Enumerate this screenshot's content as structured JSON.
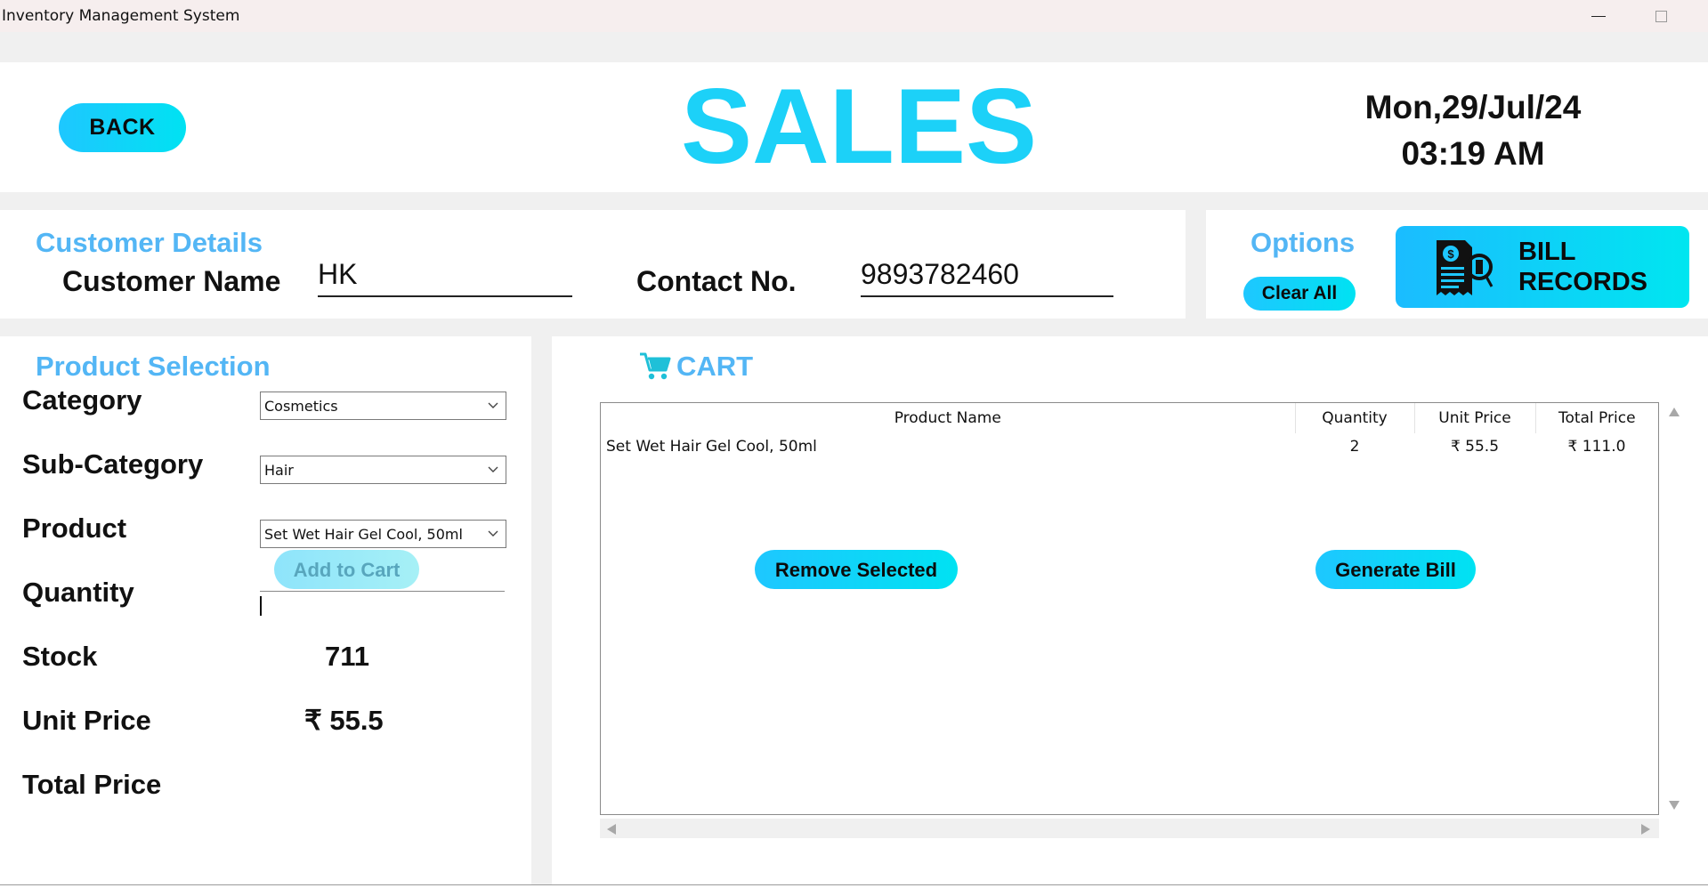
{
  "window": {
    "title": "Inventory Management System",
    "minimize_icon": "minimize-icon",
    "maximize_icon": "maximize-icon"
  },
  "header": {
    "back_label": "BACK",
    "title": "SALES",
    "date": "Mon,29/Jul/24",
    "time": "03:19 AM"
  },
  "customer": {
    "section_title": "Customer Details",
    "name_label": "Customer Name",
    "name_value": "HK",
    "contact_label": "Contact No.",
    "contact_value": "9893782460"
  },
  "options": {
    "section_title": "Options",
    "clear_label": "Clear All",
    "bill_records_line1": "BILL",
    "bill_records_line2": "RECORDS",
    "bill_icon": "bill-records-icon"
  },
  "product_selection": {
    "section_title": "Product Selection",
    "category_label": "Category",
    "category_value": "Cosmetics",
    "subcategory_label": "Sub-Category",
    "subcategory_value": "Hair",
    "product_label": "Product",
    "product_value": "Set Wet Hair Gel Cool, 50ml",
    "quantity_label": "Quantity",
    "quantity_value": "",
    "stock_label": "Stock",
    "stock_value": "711",
    "unit_price_label": "Unit Price",
    "unit_price_value": "₹ 55.5",
    "total_price_label": "Total Price",
    "total_price_value": "",
    "add_to_cart_label": "Add to Cart"
  },
  "cart": {
    "title": "CART",
    "cart_icon": "cart-icon",
    "columns": [
      "Product Name",
      "Quantity",
      "Unit Price",
      "Total Price"
    ],
    "rows": [
      [
        "Set Wet Hair Gel Cool, 50ml",
        "2",
        "₹ 55.5",
        "₹ 111.0"
      ]
    ],
    "remove_label": "Remove Selected",
    "generate_label": "Generate Bill"
  },
  "colors": {
    "accent": "#1cd1f8",
    "section_title": "#53b6f5",
    "button_gradient_start": "#1ec7ff",
    "button_gradient_end": "#00e2f2"
  }
}
